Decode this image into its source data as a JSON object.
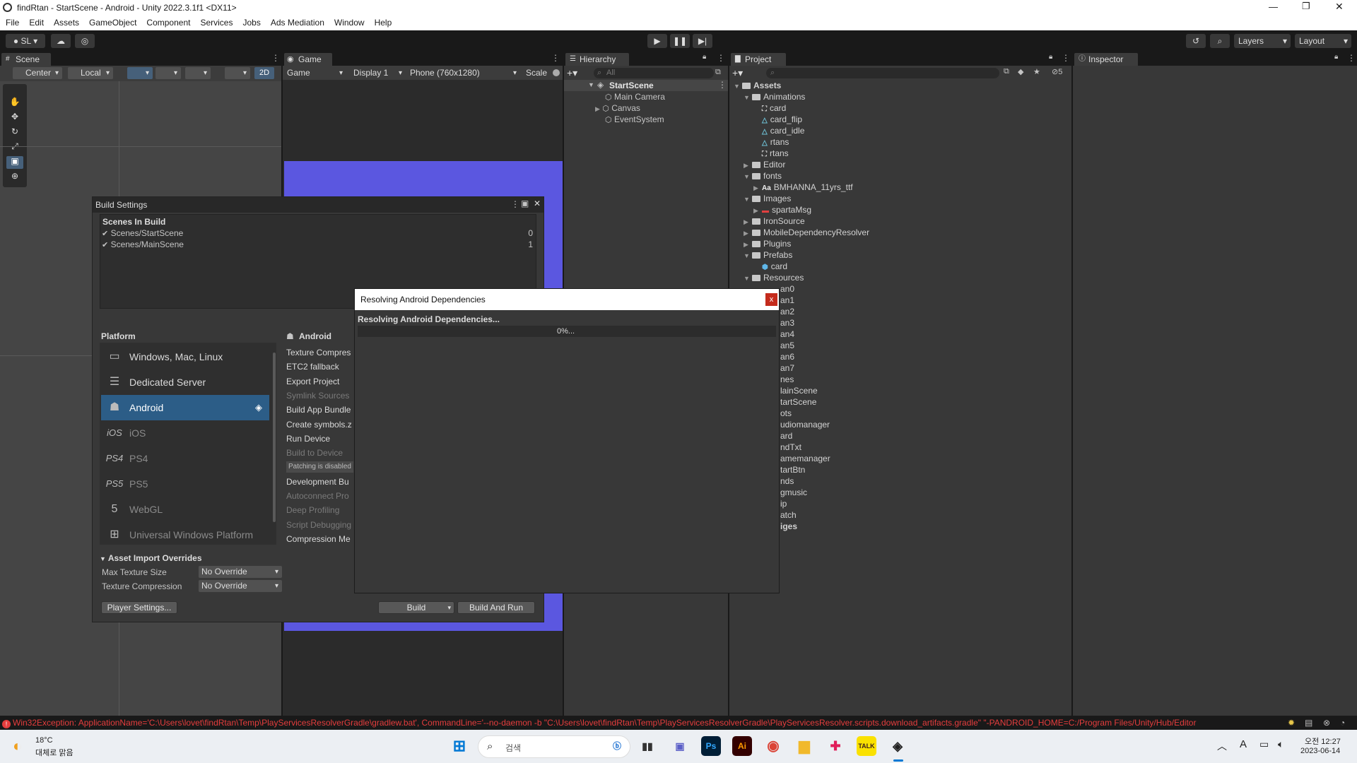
{
  "window": {
    "title": "findRtan - StartScene - Android - Unity 2022.3.1f1 <DX11>"
  },
  "menu": [
    "File",
    "Edit",
    "Assets",
    "GameObject",
    "Component",
    "Services",
    "Jobs",
    "Ads Mediation",
    "Window",
    "Help"
  ],
  "toolbar": {
    "account": "SL",
    "layers": "Layers",
    "layout": "Layout"
  },
  "scene": {
    "tab": "Scene",
    "pivot": "Center",
    "space": "Local",
    "mode2d": "2D"
  },
  "game": {
    "tab": "Game",
    "view": "Game",
    "display": "Display 1",
    "resolution": "Phone (760x1280)",
    "scale": "Scale"
  },
  "hierarchy": {
    "tab": "Hierarchy",
    "search_placeholder": "All",
    "scene": "StartScene",
    "items": [
      "Main Camera",
      "Canvas",
      "EventSystem"
    ]
  },
  "project": {
    "tab": "Project",
    "badge": "5",
    "tree": [
      {
        "label": "Assets",
        "level": 0,
        "type": "folder",
        "bold": true,
        "tri": "▼"
      },
      {
        "label": "Animations",
        "level": 1,
        "type": "folder",
        "tri": "▼"
      },
      {
        "label": "card",
        "level": 2,
        "type": "anim",
        "tri": ""
      },
      {
        "label": "card_flip",
        "level": 2,
        "type": "clip",
        "tri": ""
      },
      {
        "label": "card_idle",
        "level": 2,
        "type": "clip",
        "tri": ""
      },
      {
        "label": "rtans",
        "level": 2,
        "type": "clip",
        "tri": ""
      },
      {
        "label": "rtans",
        "level": 2,
        "type": "anim",
        "tri": ""
      },
      {
        "label": "Editor",
        "level": 1,
        "type": "folder",
        "tri": "▶"
      },
      {
        "label": "fonts",
        "level": 1,
        "type": "folder",
        "tri": "▼"
      },
      {
        "label": "BMHANNA_11yrs_ttf",
        "level": 2,
        "type": "font",
        "tri": "▶"
      },
      {
        "label": "Images",
        "level": 1,
        "type": "folder",
        "tri": "▼"
      },
      {
        "label": "spartaMsg",
        "level": 2,
        "type": "image",
        "tri": "▶"
      },
      {
        "label": "IronSource",
        "level": 1,
        "type": "folder",
        "tri": "▶"
      },
      {
        "label": "MobileDependencyResolver",
        "level": 1,
        "type": "folder",
        "tri": "▶"
      },
      {
        "label": "Plugins",
        "level": 1,
        "type": "folder",
        "tri": "▶"
      },
      {
        "label": "Prefabs",
        "level": 1,
        "type": "folder",
        "tri": "▼"
      },
      {
        "label": "card",
        "level": 2,
        "type": "prefab",
        "tri": ""
      },
      {
        "label": "Resources",
        "level": 1,
        "type": "folder",
        "tri": "▼"
      }
    ],
    "hidden_rows": [
      "an0",
      "an1",
      "an2",
      "an3",
      "an4",
      "an5",
      "an6",
      "an7",
      "nes",
      "lainScene",
      "tartScene",
      "ots",
      "udiomanager",
      "ard",
      "ndTxt",
      "amemanager",
      "tartBtn",
      "nds",
      "gmusic",
      "ip",
      "atch",
      "iges"
    ]
  },
  "inspector": {
    "tab": "Inspector"
  },
  "build": {
    "title": "Build Settings",
    "scenes_header": "Scenes In Build",
    "scenes": [
      {
        "name": "Scenes/StartScene",
        "index": "0"
      },
      {
        "name": "Scenes/MainScene",
        "index": "1"
      }
    ],
    "platform_header": "Platform",
    "platforms": [
      {
        "name": "Windows, Mac, Linux",
        "icon": "monitor-icon",
        "glyph": "▭"
      },
      {
        "name": "Dedicated Server",
        "icon": "server-icon",
        "glyph": "☰"
      },
      {
        "name": "Android",
        "icon": "android-icon",
        "glyph": "☗"
      },
      {
        "name": "iOS",
        "icon": "ios-icon",
        "glyph": "iOS"
      },
      {
        "name": "PS4",
        "icon": "ps4-icon",
        "glyph": "PS4"
      },
      {
        "name": "PS5",
        "icon": "ps5-icon",
        "glyph": "PS5"
      },
      {
        "name": "WebGL",
        "icon": "html5-icon",
        "glyph": "5"
      },
      {
        "name": "Universal Windows Platform",
        "icon": "windows-icon",
        "glyph": "⊞"
      }
    ],
    "selected_platform": "Android",
    "settings": [
      "Texture Compres",
      "ETC2 fallback",
      "Export Project",
      "Symlink Sources",
      "Build App Bundle",
      "Create symbols.z",
      "Run Device",
      "Build to Device",
      "Patching is disabled",
      "Development Bu",
      "Autoconnect Pro",
      "Deep Profiling",
      "Script Debugging",
      "Compression Me"
    ],
    "overrides_header": "Asset Import Overrides",
    "max_texture_label": "Max Texture Size",
    "max_texture_value": "No Override",
    "texture_comp_label": "Texture Compression",
    "texture_comp_value": "No Override",
    "player_settings": "Player Settings...",
    "build": "Build",
    "build_and_run": "Build And Run"
  },
  "dialog": {
    "title": "Resolving Android Dependencies",
    "message": "Resolving Android Dependencies...",
    "progress_text": "0%...",
    "progress": 0
  },
  "statusbar": {
    "message": "Win32Exception: ApplicationName='C:\\Users\\lovet\\findRtan\\Temp\\PlayServicesResolverGradle\\gradlew.bat', CommandLine='--no-daemon -b \"C:\\Users\\lovet\\findRtan\\Temp\\PlayServicesResolverGradle\\PlayServicesResolver.scripts.download_artifacts.gradle\" \"-PANDROID_HOME=C:/Program Files/Unity/Hub/Editor"
  },
  "taskbar": {
    "temp": "18°C",
    "weather": "대체로 맑음",
    "search": "검색",
    "time": "오전 12:27",
    "date": "2023-06-14",
    "lang": "A"
  }
}
